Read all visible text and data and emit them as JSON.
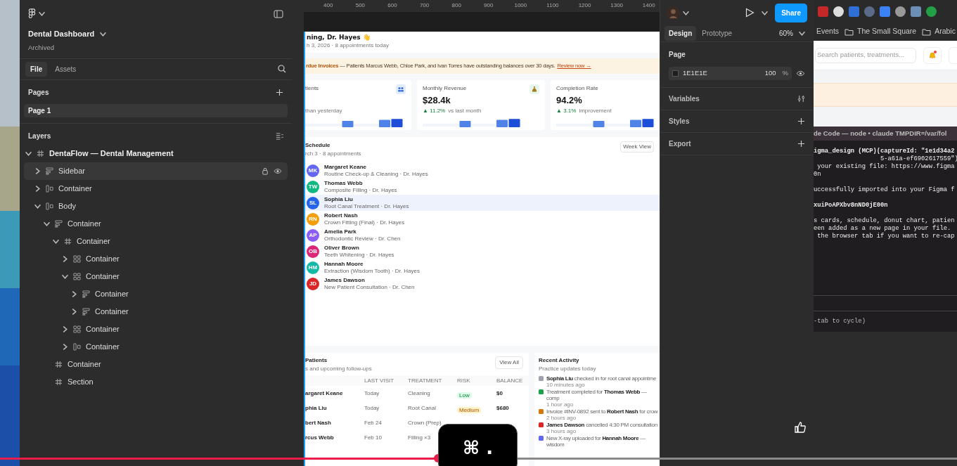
{
  "file_panel": {
    "title": "Dental Dashboard",
    "status": "Archived",
    "tabs": [
      {
        "label": "File",
        "selected": true
      },
      {
        "label": "Assets",
        "selected": false
      }
    ],
    "pages_heading": "Pages",
    "pages": [
      {
        "label": "Page 1",
        "selected": true
      }
    ],
    "layers_heading": "Layers",
    "layers": [
      {
        "name": "DentaFlow — Dental Management",
        "kind": "frame",
        "expanded": true,
        "hovered": false,
        "children": [
          {
            "name": "Sidebar",
            "kind": "section",
            "expanded": false,
            "hovered": true
          },
          {
            "name": "Container",
            "kind": "row",
            "expanded": false,
            "hovered": false
          },
          {
            "name": "Body",
            "kind": "row",
            "expanded": true,
            "hovered": false,
            "children": [
              {
                "name": "Container",
                "kind": "section",
                "expanded": true,
                "hovered": false,
                "children": [
                  {
                    "name": "Container",
                    "kind": "frame",
                    "expanded": true,
                    "hovered": false,
                    "children": [
                      {
                        "name": "Container",
                        "kind": "grid",
                        "expanded": false,
                        "hovered": false
                      },
                      {
                        "name": "Container",
                        "kind": "grid",
                        "expanded": true,
                        "hovered": false,
                        "children": [
                          {
                            "name": "Container",
                            "kind": "section",
                            "expanded": false,
                            "hovered": false
                          },
                          {
                            "name": "Container",
                            "kind": "section",
                            "expanded": false,
                            "hovered": false
                          }
                        ]
                      },
                      {
                        "name": "Container",
                        "kind": "grid",
                        "expanded": false,
                        "hovered": false
                      },
                      {
                        "name": "Container",
                        "kind": "row",
                        "expanded": false,
                        "hovered": false
                      }
                    ]
                  }
                ]
              },
              {
                "name": "Container",
                "kind": "frame",
                "hovered": false
              },
              {
                "name": "Section",
                "kind": "frame",
                "hovered": false
              }
            ]
          }
        ]
      }
    ]
  },
  "canvas": {
    "ruler": [
      "400",
      "500",
      "600",
      "700",
      "800",
      "900",
      "1000",
      "1100",
      "1200",
      "1300",
      "1400"
    ],
    "dashboard": {
      "greeting": "ning, Dr. Hayes 👋",
      "subtitle": "h 3, 2026 · 8 appointments today",
      "alert": {
        "text": "**rdue Invoices** — Patients Marcus Webb, Chloe Park, and Ivan Torres have outstanding balances over 30 days.",
        "link": "Review now →"
      },
      "stats": [
        {
          "label": "tients",
          "note": "than yesterday"
        },
        {
          "label": "Monthly Revenue",
          "value": "$28.4k",
          "delta": "▲ 11.2%",
          "note": "vs last month"
        },
        {
          "label": "Completion Rate",
          "value": "94.2%",
          "delta": "▲ 3.1%",
          "note": "improvement"
        }
      ],
      "schedule": {
        "title": "Schedule",
        "subtitle": "rch 3 · 8 appointments",
        "button": "Week View",
        "rows": [
          {
            "initials": "MK",
            "color": "#6366f1",
            "name": "Margaret Keane",
            "detail": "Routine Check-up & Cleaning · Dr. Hayes",
            "selected": false
          },
          {
            "initials": "TW",
            "color": "#10b981",
            "name": "Thomas Webb",
            "detail": "Composite Filling · Dr. Hayes",
            "selected": false
          },
          {
            "initials": "SL",
            "color": "#2563eb",
            "name": "Sophia Liu",
            "detail": "Root Canal Treatment · Dr. Hayes",
            "selected": true
          },
          {
            "initials": "RN",
            "color": "#f59e0b",
            "name": "Robert Nash",
            "detail": "Crown Fitting (Final) · Dr. Hayes",
            "selected": false
          },
          {
            "initials": "AP",
            "color": "#8b5cf6",
            "name": "Amelia Park",
            "detail": "Orthodontic Review · Dr. Chen",
            "selected": false
          },
          {
            "initials": "OB",
            "color": "#db2777",
            "name": "Oliver Brown",
            "detail": "Teeth Whitening · Dr. Hayes",
            "selected": false
          },
          {
            "initials": "HM",
            "color": "#14b8a6",
            "name": "Hannah Moore",
            "detail": "Extraction (Wisdom Tooth) · Dr. Hayes",
            "selected": false
          },
          {
            "initials": "JD",
            "color": "#dc2626",
            "name": "James Dawson",
            "detail": "New Patient Consultation · Dr. Chen",
            "selected": false
          }
        ]
      },
      "patients": {
        "title": "Patients",
        "subtitle": "s and upcoming follow-ups",
        "button": "View All",
        "columns": [
          "LAST VISIT",
          "TREATMENT",
          "RISK",
          "BALANCE"
        ],
        "rows": [
          {
            "name": "argaret Keane",
            "last_visit": "Today",
            "treatment": "Cleaning",
            "risk": {
              "label": "Low",
              "kind": "low"
            },
            "balance": "$0"
          },
          {
            "name": "phia Liu",
            "last_visit": "Today",
            "treatment": "Root Canal",
            "risk": {
              "label": "Medium",
              "kind": "medium"
            },
            "balance": "$680"
          },
          {
            "name": "bert Nash",
            "last_visit": "Feb 24",
            "treatment": "Crown (Prep)"
          },
          {
            "name": "rcus Webb",
            "last_visit": "Feb 10",
            "treatment": "Filling ×3"
          }
        ]
      },
      "activity": {
        "title": "Recent Activity",
        "subtitle": "Practice updates today",
        "items": [
          {
            "color": "#9ca3af",
            "text": "**Sophia Liu** checked in for root canal appointme",
            "time": "10 minutes ago"
          },
          {
            "color": "#16a34a",
            "text": "Treatment completed for **Thomas Webb** — comp",
            "time": "1 hour ago"
          },
          {
            "color": "#d97706",
            "text": "Invoice #INV-0892 sent to **Robert Nash** for crow",
            "time": "2 hours ago"
          },
          {
            "color": "#dc2626",
            "text": "**James Dawson** cancelled 4:30 PM consultation",
            "time": "3 hours ago"
          },
          {
            "color": "#6366f1",
            "text": "New X-ray uploaded for **Hannah Moore** — wisdom"
          }
        ]
      }
    }
  },
  "inspector": {
    "share": "Share",
    "tabs": [
      {
        "label": "Design",
        "selected": true
      },
      {
        "label": "Prototype",
        "selected": false
      }
    ],
    "zoom": "60%",
    "page": {
      "heading": "Page",
      "color": "1E1E1E",
      "opacity": "100",
      "unit": "%"
    },
    "sections": [
      {
        "label": "Variables",
        "kind": "variables"
      },
      {
        "label": "Styles",
        "kind": "add"
      },
      {
        "label": "Export",
        "kind": "add"
      }
    ]
  },
  "browser": {
    "bookmarks": [
      "Events",
      "The Small Square",
      "Arabic"
    ],
    "search_placeholder": "Search patients, treatments...",
    "notification": true
  },
  "terminal": {
    "title": "de Code — node • claude TMPDIR=/var/fol",
    "blocks": [
      [
        {
          "text": "igma_design (MCP)(captureId: \"1e1d34a2",
          "bold": true
        },
        {
          "text": "                  5-a61a-ef6902617559\")",
          "bold": false
        },
        {
          "text": " your existing file: https://www.figma",
          "bold": false
        },
        {
          "text": "0n",
          "bold": false
        }
      ],
      [
        {
          "text": "uccessfully imported into your Figma f",
          "bold": false
        }
      ],
      [
        {
          "text": "xuiPoAPXbv8nND0jE00n",
          "bold": true
        }
      ],
      [
        {
          "text": "s cards, schedule, donut chart, patien",
          "bold": false
        },
        {
          "text": "een added as a new page in your file.",
          "bold": false
        },
        {
          "text": " the browser tab if you want to re-cap",
          "bold": false
        }
      ]
    ],
    "hint": "-tab to cycle)"
  },
  "video": {
    "progress": {
      "level": 0.458
    },
    "keys": "⌘ ."
  }
}
